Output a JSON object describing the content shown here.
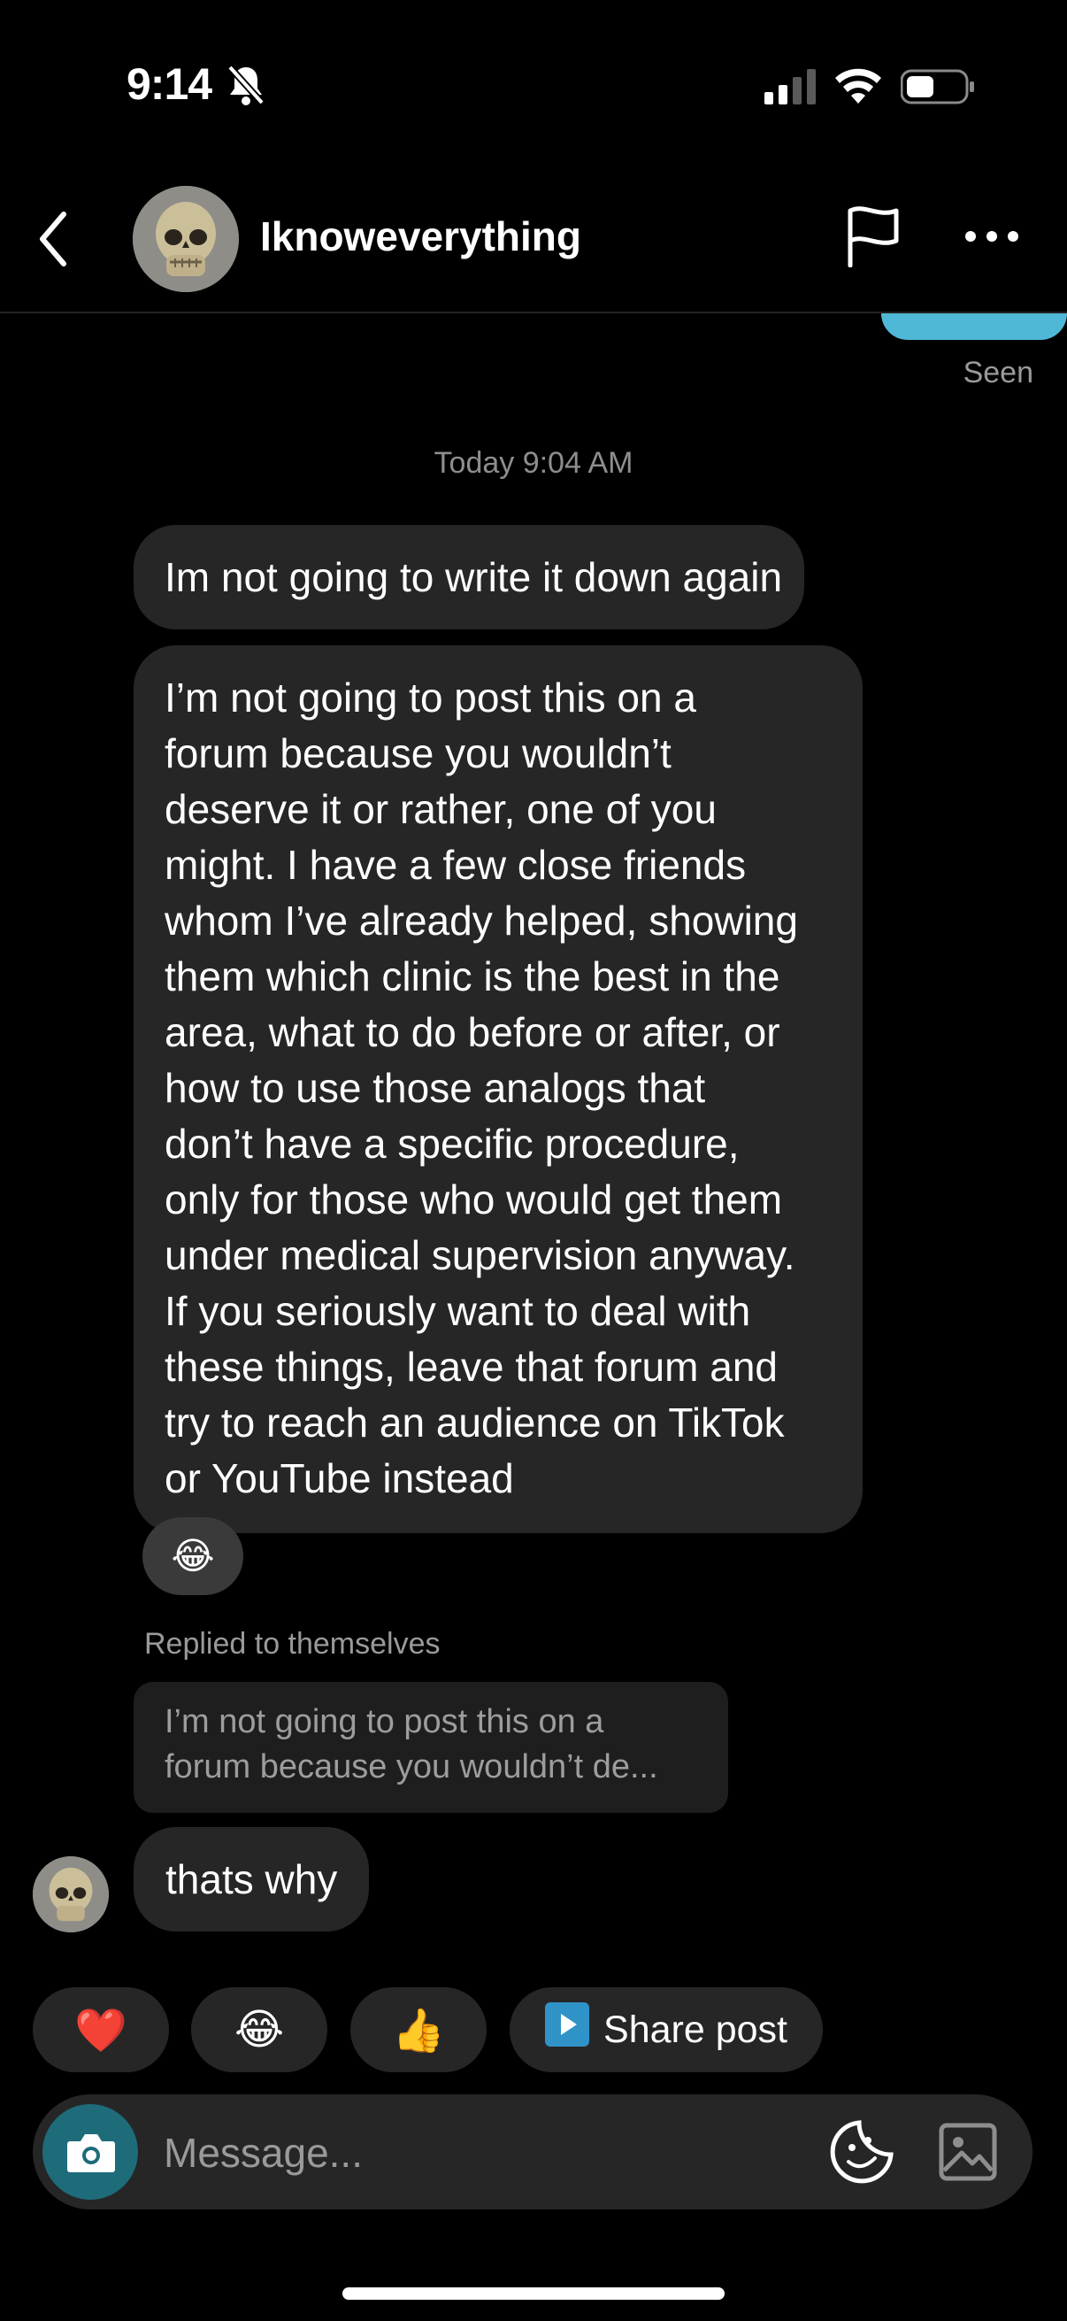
{
  "status_bar": {
    "time": "9:14"
  },
  "header": {
    "username": "Iknoweverything"
  },
  "thread": {
    "seen_label": "Seen",
    "timestamp": "Today 9:04 AM",
    "messages": [
      {
        "text": "Im not going to write it down again"
      },
      {
        "text": "I’m not going to post this on a\nforum because you wouldn’t\ndeserve it or rather, one of you\nmight. I have a few close friends\nwhom I’ve already helped, showing\nthem which clinic is the best in the\narea, what to do before or after, or\nhow to use those analogs that\ndon’t have a specific procedure,\nonly for those who would get them\nunder medical supervision anyway.\nIf you seriously want to deal with\nthese things, leave that forum and\ntry to reach an audience on TikTok\nor YouTube instead"
      },
      {
        "reaction": "😂"
      }
    ],
    "reply": {
      "label": "Replied to themselves",
      "quote": "I’m not going to post this on a\nforum because you wouldn’t de...",
      "text": "thats why"
    }
  },
  "quick_reactions": [
    "❤️",
    "😂",
    "👍"
  ],
  "share_post_label": "Share post",
  "composer": {
    "placeholder": "Message..."
  },
  "colors": {
    "background": "#000000",
    "bubble": "#262626",
    "accent": "#4fb8d6",
    "camera": "#1e6b7a"
  },
  "icons": [
    "bell-slash-icon",
    "signal-icon",
    "wifi-icon",
    "battery-icon",
    "back-icon",
    "flag-icon",
    "more-icon",
    "camera-icon",
    "sticker-icon",
    "gallery-icon",
    "play-icon"
  ]
}
